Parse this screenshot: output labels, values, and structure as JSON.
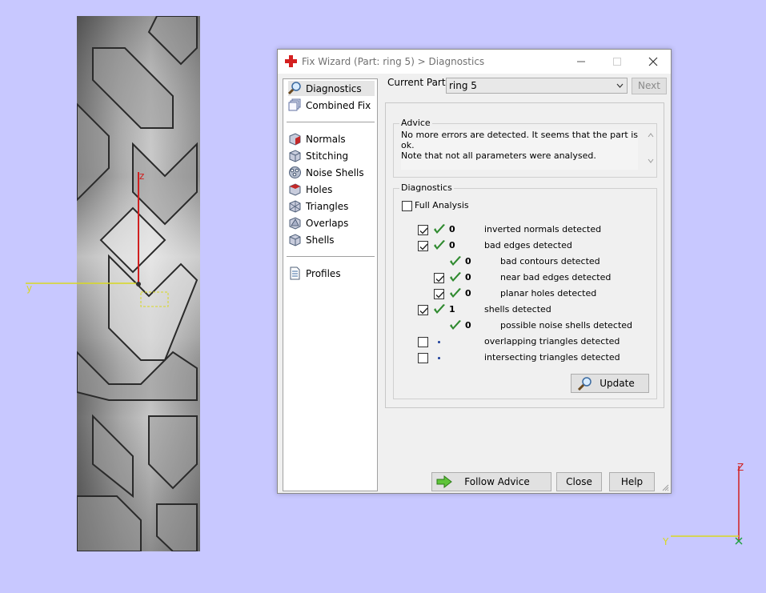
{
  "window": {
    "title": "Fix Wizard (Part: ring 5) > Diagnostics"
  },
  "nav": {
    "items": [
      {
        "label": "Diagnostics",
        "icon": "magnifier-icon",
        "selected": true
      },
      {
        "label": "Combined Fix",
        "icon": "layers-icon"
      },
      {
        "label": "Normals",
        "icon": "normals-cube-icon"
      },
      {
        "label": "Stitching",
        "icon": "stitching-cube-icon"
      },
      {
        "label": "Noise Shells",
        "icon": "noise-shells-icon"
      },
      {
        "label": "Holes",
        "icon": "holes-cube-icon"
      },
      {
        "label": "Triangles",
        "icon": "triangles-icon"
      },
      {
        "label": "Overlaps",
        "icon": "overlaps-icon"
      },
      {
        "label": "Shells",
        "icon": "shells-icon"
      },
      {
        "label": "Profiles",
        "icon": "document-icon"
      }
    ]
  },
  "current_part": {
    "label": "Current Part:",
    "value": "ring 5",
    "next_label": "Next"
  },
  "advice": {
    "title": "Advice",
    "line1": "No more errors are detected. It seems that the part is ok.",
    "line2": "Note that not all parameters were analysed."
  },
  "diagnostics": {
    "title": "Diagnostics",
    "full_analysis_label": "Full Analysis",
    "full_analysis_checked": false,
    "rows": [
      {
        "checkbox": true,
        "checked": true,
        "status": "ok",
        "count": "0",
        "label": "inverted normals detected",
        "indent": 0
      },
      {
        "checkbox": true,
        "checked": true,
        "status": "ok",
        "count": "0",
        "label": "bad edges detected",
        "indent": 0
      },
      {
        "checkbox": false,
        "checked": false,
        "status": "ok",
        "count": "0",
        "label": "bad contours detected",
        "indent": 1
      },
      {
        "checkbox": true,
        "checked": true,
        "status": "ok",
        "count": "0",
        "label": "near bad edges detected",
        "indent": 1
      },
      {
        "checkbox": true,
        "checked": true,
        "status": "ok",
        "count": "0",
        "label": "planar holes detected",
        "indent": 1
      },
      {
        "checkbox": true,
        "checked": true,
        "status": "ok",
        "count": "1",
        "label": "shells detected",
        "indent": 0
      },
      {
        "checkbox": false,
        "checked": false,
        "status": "ok",
        "count": "0",
        "label": "possible noise shells detected",
        "indent": 1
      },
      {
        "checkbox": true,
        "checked": false,
        "status": "none",
        "count": "",
        "label": "overlapping triangles detected",
        "indent": 0
      },
      {
        "checkbox": true,
        "checked": false,
        "status": "none",
        "count": "",
        "label": "intersecting triangles detected",
        "indent": 0
      }
    ],
    "update_label": "Update"
  },
  "buttons": {
    "follow_advice": "Follow Advice",
    "close": "Close",
    "help": "Help"
  },
  "viewport": {
    "axis_z": "z",
    "axis_y": "y",
    "label_box": "",
    "corner_axis_z": "Z",
    "corner_axis_y": "Y",
    "background": "#c8c8ff"
  },
  "colors": {
    "check_green": "#2f8a2f",
    "axis_red": "#d02020",
    "axis_yellow": "#d8d820",
    "dialog_bg": "#f0f0f0"
  }
}
